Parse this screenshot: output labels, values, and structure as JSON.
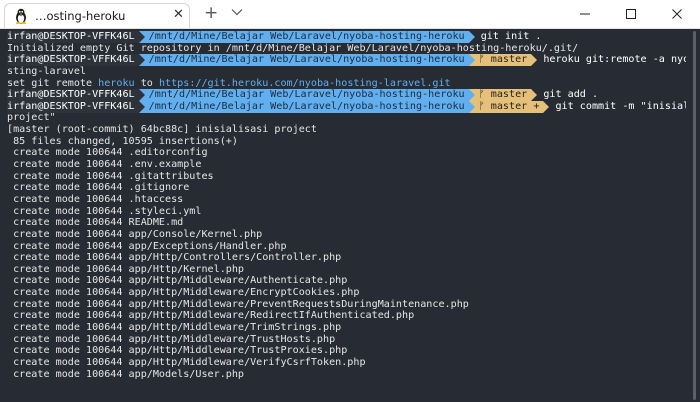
{
  "window": {
    "tab_title": "…osting-heroku",
    "tab_close": "✕",
    "new_tab": "+"
  },
  "prompt": {
    "user": "irfan@DESKTOP-VFFK46L",
    "path": "/mnt/d/Mine/Belajar Web/Laravel/nyoba-hosting-heroku",
    "git_branch_glyph": "ᚠ",
    "branch": "master",
    "dirty_marker": "+"
  },
  "terminal": {
    "cmd1": "git init .",
    "out1": "Initialized empty Git repository in /mnt/d/Mine/Belajar Web/Laravel/nyoba-hosting-heroku/.git/",
    "cmd2_a": "heroku git:remote -a nyoba-ho",
    "cmd2_b": "sting-laravel",
    "out2_prefix": "set git remote ",
    "out2_remote": "heroku",
    "out2_mid": " to ",
    "out2_url": "https://git.heroku.com/nyoba-hosting-laravel.git",
    "cmd3": "git add .",
    "cmd4_a": "git commit -m \"inisialisasi",
    "cmd4_b": "project\"",
    "out_commit": "[master (root-commit) 64bc88c] inisialisasi project",
    "out_stats": " 85 files changed, 10595 insertions(+)",
    "created_files": [
      " create mode 100644 .editorconfig",
      " create mode 100644 .env.example",
      " create mode 100644 .gitattributes",
      " create mode 100644 .gitignore",
      " create mode 100644 .htaccess",
      " create mode 100644 .styleci.yml",
      " create mode 100644 README.md",
      " create mode 100644 app/Console/Kernel.php",
      " create mode 100644 app/Exceptions/Handler.php",
      " create mode 100644 app/Http/Controllers/Controller.php",
      " create mode 100644 app/Http/Kernel.php",
      " create mode 100644 app/Http/Middleware/Authenticate.php",
      " create mode 100644 app/Http/Middleware/EncryptCookies.php",
      " create mode 100644 app/Http/Middleware/PreventRequestsDuringMaintenance.php",
      " create mode 100644 app/Http/Middleware/RedirectIfAuthenticated.php",
      " create mode 100644 app/Http/Middleware/TrimStrings.php",
      " create mode 100644 app/Http/Middleware/TrustHosts.php",
      " create mode 100644 app/Http/Middleware/TrustProxies.php",
      " create mode 100644 app/Http/Middleware/VerifyCsrfToken.php",
      " create mode 100644 app/Models/User.php"
    ]
  },
  "colors": {
    "terminal_bg": "#272b33",
    "path_segment": "#61afef",
    "git_segment": "#e5c07b",
    "user_segment": "#2e323b",
    "link": "#61afef"
  },
  "icons": {
    "tab": "linux-tux-icon",
    "dropdown": "chevron-down-icon",
    "minimize": "minimize-icon",
    "maximize": "maximize-icon",
    "close": "close-icon"
  }
}
